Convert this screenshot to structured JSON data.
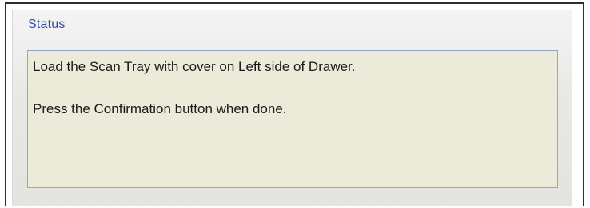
{
  "status_panel": {
    "title": "Status",
    "messages": [
      "Load the Scan Tray with cover on Left side of Drawer.",
      "Press the Confirmation button when done."
    ]
  }
}
